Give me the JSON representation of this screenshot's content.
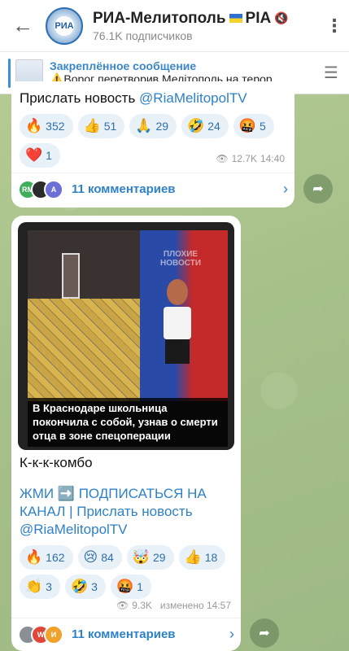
{
  "header": {
    "back_icon": "arrow-left-icon",
    "title": "РИА-Мелитополь",
    "title_suffix": "PIA",
    "subscribers": "76.1K подписчиков",
    "avatar_text": "РИА",
    "menu_icon": "vertical-dots-icon"
  },
  "pinned": {
    "title": "Закреплённое сообщение",
    "text": "⚠️Ворог перетворив Мелітополь на терор…"
  },
  "message1": {
    "text": "Прислать новость @RiaMelitopolTV",
    "text_prefix": "Прислать новость ",
    "link": "@RiaMelitopolTV",
    "reactions": [
      {
        "emoji": "🔥",
        "count": "352"
      },
      {
        "emoji": "👍",
        "count": "51"
      },
      {
        "emoji": "🙏",
        "count": "29"
      },
      {
        "emoji": "🤣",
        "count": "24"
      },
      {
        "emoji": "🤬",
        "count": "5"
      },
      {
        "emoji": "❤️",
        "count": "1"
      }
    ],
    "views": "12.7K",
    "time": "14:40",
    "comments_label": "11 комментариев",
    "comment_avatars": [
      "RM",
      "",
      "A"
    ]
  },
  "message2": {
    "photo_caption": "В Краснодаре школьница покончила с собой, узнав о смерти отца в зоне спецоперации",
    "watermark": "ПЛОХИЕ НОВОСТИ",
    "body_line1": "К-к-к-комбо",
    "cta": "ЖМИ ➡️ ПОДПИСАТЬСЯ НА КАНАЛ | Прислать новость",
    "link": "@RiaMelitopolTV",
    "reactions": [
      {
        "emoji": "🔥",
        "count": "162"
      },
      {
        "emoji": "😢",
        "count": "84"
      },
      {
        "emoji": "🤯",
        "count": "29"
      },
      {
        "emoji": "👍",
        "count": "18"
      },
      {
        "emoji": "👏",
        "count": "3"
      },
      {
        "emoji": "🤣",
        "count": "3"
      },
      {
        "emoji": "🤬",
        "count": "1"
      }
    ],
    "views": "9.3K",
    "edited_time": "изменено 14:57",
    "comments_label": "11 комментариев",
    "comment_avatars": [
      "",
      "W",
      "И"
    ]
  },
  "colors": {
    "accent": "#2f81c7",
    "chat_bg": "#a9c38e"
  }
}
